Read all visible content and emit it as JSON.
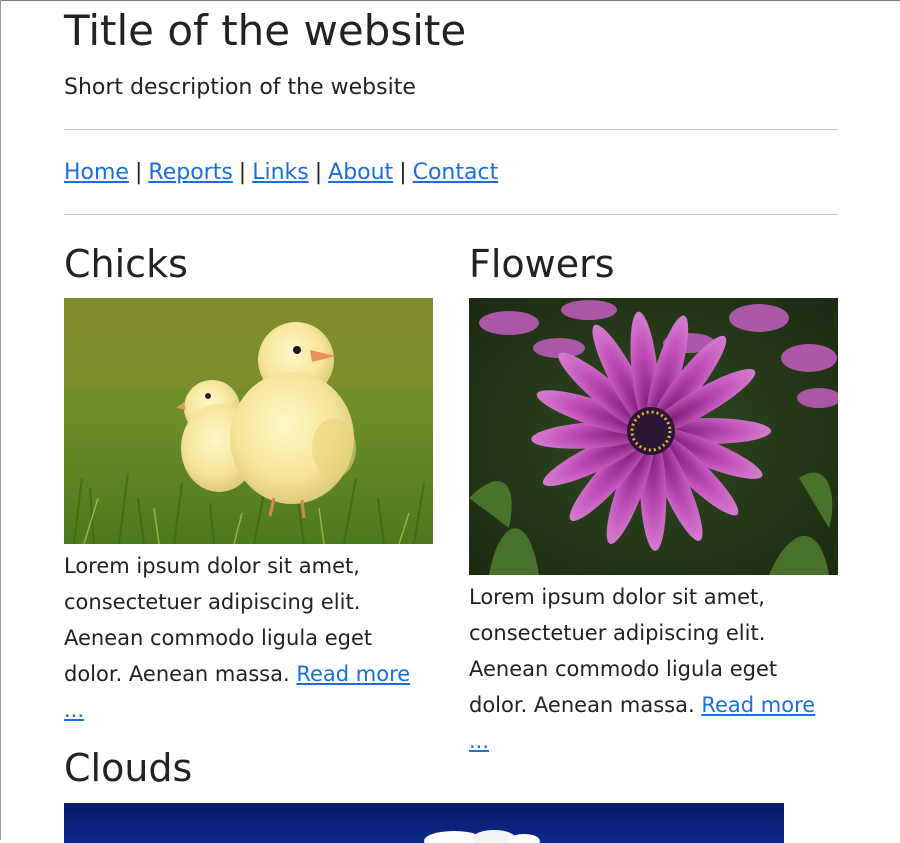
{
  "site": {
    "title": "Title of the website",
    "description": "Short description of the website"
  },
  "nav": {
    "items": [
      "Home",
      "Reports",
      "Links",
      "About",
      "Contact"
    ],
    "separator": "|"
  },
  "cards": [
    {
      "title": "Chicks",
      "image": "photo-chicks-in-grass",
      "text": "Lorem ipsum dolor sit amet, consectetuer adipiscing elit. Aenean commodo ligula eget dolor. Aenean massa.",
      "link": "Read more ..."
    },
    {
      "title": "Flowers",
      "image": "photo-pink-daisy-flowers",
      "text": "Lorem ipsum dolor sit amet, consectetuer adipiscing elit. Aenean commodo ligula eget dolor. Aenean massa.",
      "link": "Read more ..."
    },
    {
      "title": "Clouds",
      "image": "photo-clouds-night-sky"
    }
  ],
  "colors": {
    "link": "#1a6fe0",
    "text": "#222222",
    "rule": "#cfcfcf"
  }
}
